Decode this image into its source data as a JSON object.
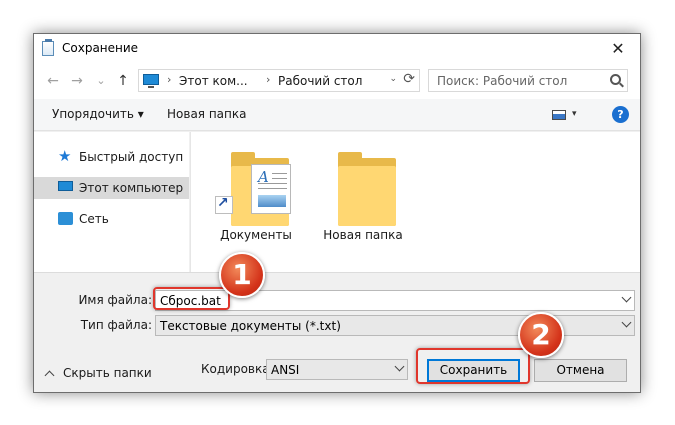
{
  "window": {
    "title": "Сохранение",
    "close_glyph": "✕"
  },
  "address": {
    "back_glyph": "←",
    "forward_glyph": "→",
    "recent_glyph": "⌄",
    "up_glyph": "↑",
    "crumbs": [
      "Этот ком...",
      "Рабочий стол"
    ],
    "sep_glyph": "›",
    "dropdown_glyph": "⌄",
    "refresh_glyph": "⟳",
    "search_placeholder": "Поиск: Рабочий стол"
  },
  "toolbar": {
    "organize_label": "Упорядочить ▾",
    "new_folder_label": "Новая папка",
    "view_drop_glyph": "▾",
    "help_glyph": "?"
  },
  "nav": {
    "items": [
      {
        "label": "Быстрый доступ",
        "icon": "star-icon"
      },
      {
        "label": "Этот компьютер",
        "icon": "computer-icon"
      },
      {
        "label": "Сеть",
        "icon": "network-icon"
      }
    ],
    "selected_index": 1
  },
  "content": {
    "items": [
      {
        "label": "Документы",
        "icon": "documents-folder-icon"
      },
      {
        "label": "Новая папка",
        "icon": "folder-icon"
      }
    ],
    "doc_letter": "A"
  },
  "form": {
    "filename_label": "Имя файла:",
    "filename_value": "Сброс.bat",
    "filetype_label": "Тип файла:",
    "filetype_value": "Текстовые документы (*.txt)",
    "encoding_label": "Кодировка:",
    "encoding_value": "ANSI",
    "hide_folders_label": "Скрыть папки",
    "save_label": "Сохранить",
    "cancel_label": "Отмена"
  },
  "annotations": {
    "badge_1": "1",
    "badge_2": "2",
    "color": "#d4331a"
  }
}
